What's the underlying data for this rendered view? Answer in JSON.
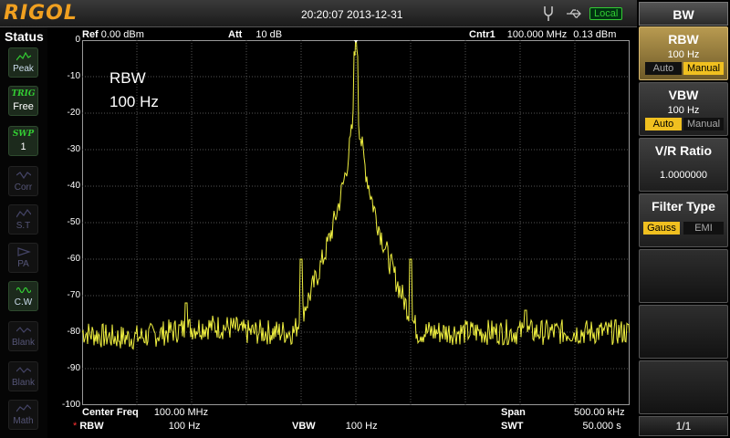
{
  "header": {
    "logo": "RIGOL",
    "datetime": "20:20:07 2013-12-31",
    "local": "Local"
  },
  "status": {
    "title": "Status",
    "buttons": [
      {
        "name": "peak",
        "label": "Peak",
        "italic": "",
        "value": ""
      },
      {
        "name": "trig",
        "label": "",
        "italic": "TRIG",
        "value": "Free"
      },
      {
        "name": "swp",
        "label": "",
        "italic": "SWP",
        "value": "1"
      },
      {
        "name": "corr",
        "label": "Corr",
        "italic": "",
        "value": ""
      },
      {
        "name": "st",
        "label": "S.T",
        "italic": "",
        "value": ""
      },
      {
        "name": "pa",
        "label": "PA",
        "italic": "",
        "value": ""
      },
      {
        "name": "cw",
        "label": "C.W",
        "italic": "",
        "value": ""
      },
      {
        "name": "blank1",
        "label": "Blank",
        "italic": "",
        "value": ""
      },
      {
        "name": "blank2",
        "label": "Blank",
        "italic": "",
        "value": ""
      },
      {
        "name": "math",
        "label": "Math",
        "italic": "",
        "value": ""
      }
    ]
  },
  "plot": {
    "ref_label": "Ref",
    "ref_value": "0.00 dBm",
    "att_label": "Att",
    "att_value": "10 dB",
    "cntr_label": "Cntr1",
    "cntr_value": "100.000 MHz",
    "cntr_level": "0.13 dBm",
    "overlay_line1": "RBW",
    "overlay_line2": "100 Hz",
    "y_ticks": [
      "0",
      "-10",
      "-20",
      "-30",
      "-40",
      "-50",
      "-60",
      "-70",
      "-80",
      "-90",
      "-100"
    ],
    "y_top": 0,
    "y_bottom": -100,
    "center_label": "Center Freq",
    "center_value": "100.00 MHz",
    "span_label": "Span",
    "span_value": "500.00 kHz",
    "rbw_star": "*",
    "rbw_label": "RBW",
    "rbw_value": "100 Hz",
    "vbw_label": "VBW",
    "vbw_value": "100 Hz",
    "swt_label": "SWT",
    "swt_value": "50.000 s",
    "trace_color": "#f0f040",
    "trace": {
      "noise_floor_db": -80,
      "peak_db": 0,
      "peak_x_fraction": 0.5,
      "sidebands": [
        {
          "x_fraction": 0.4,
          "level_db": -60
        },
        {
          "x_fraction": 0.6,
          "level_db": -60
        }
      ],
      "spikes": [
        {
          "x_fraction": 0.19,
          "level_db": -72
        },
        {
          "x_fraction": 0.81,
          "level_db": -74
        }
      ]
    }
  },
  "menu": {
    "title": "BW",
    "rbw": {
      "label": "RBW",
      "value": "100 Hz",
      "opt_a": "Auto",
      "opt_b": "Manual"
    },
    "vbw": {
      "label": "VBW",
      "value": "100 Hz",
      "opt_a": "Auto",
      "opt_b": "Manual"
    },
    "vr": {
      "label": "V/R Ratio",
      "value": "1.0000000"
    },
    "filter": {
      "label": "Filter Type",
      "opt_a": "Gauss",
      "opt_b": "EMI"
    },
    "page": "1/1"
  }
}
